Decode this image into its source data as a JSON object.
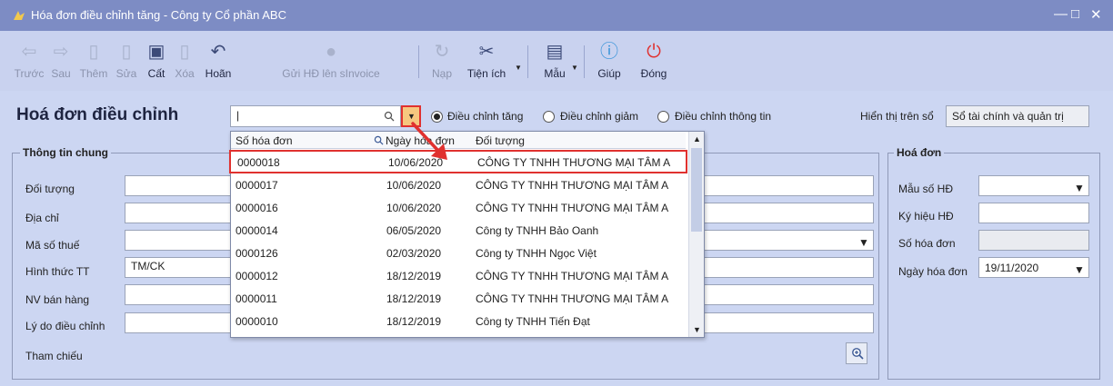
{
  "window": {
    "title": "Hóa đơn điều chỉnh tăng - Công ty Cổ phần ABC",
    "controls": [
      "—",
      "□",
      "✕"
    ]
  },
  "toolbar": {
    "buttons": [
      {
        "label": "Trước",
        "enabled": false
      },
      {
        "label": "Sau",
        "enabled": false
      },
      {
        "label": "Thêm",
        "enabled": false
      },
      {
        "label": "Sửa",
        "enabled": false
      },
      {
        "label": "Cất",
        "enabled": true
      },
      {
        "label": "Xóa",
        "enabled": false
      },
      {
        "label": "Hoãn",
        "enabled": true
      },
      {
        "label": "Gửi HĐ lên sInvoice",
        "enabled": false
      },
      {
        "label": "Nạp",
        "enabled": false
      },
      {
        "label": "Tiện ích",
        "enabled": true
      },
      {
        "label": "Mẫu",
        "enabled": true
      },
      {
        "label": "Giúp",
        "enabled": true
      },
      {
        "label": "Đóng",
        "enabled": true
      }
    ]
  },
  "form": {
    "heading": "Hoá đơn điều chỉnh",
    "search_value": "|",
    "radios": [
      {
        "label": "Điều chỉnh tăng",
        "checked": true
      },
      {
        "label": "Điều chỉnh giảm",
        "checked": false
      },
      {
        "label": "Điều chỉnh thông tin",
        "checked": false
      }
    ],
    "display_label": "Hiển thị trên sổ",
    "display_value": "Sổ tài chính và quản trị"
  },
  "general": {
    "title": "Thông tin chung",
    "fields": [
      {
        "label": "Đối tượng",
        "value": ""
      },
      {
        "label": "Địa chỉ",
        "value": ""
      },
      {
        "label": "Mã số thuế",
        "value": ""
      },
      {
        "label": "Hình thức TT",
        "value": "TM/CK"
      },
      {
        "label": "NV bán hàng",
        "value": ""
      },
      {
        "label": "Lý do điều chỉnh",
        "value": ""
      }
    ],
    "reference_label": "Tham chiếu"
  },
  "invoice": {
    "title": "Hoá đơn",
    "fields": [
      {
        "label": "Mẫu số HĐ",
        "value": ""
      },
      {
        "label": "Ký hiệu HĐ",
        "value": ""
      },
      {
        "label": "Số hóa đơn",
        "value": ""
      },
      {
        "label": "Ngày hóa đơn",
        "value": "19/11/2020"
      }
    ]
  },
  "dropdown": {
    "columns": [
      "Số hóa đơn",
      "Ngày hóa đơn",
      "Đối tượng"
    ],
    "rows": [
      {
        "number": "0000018",
        "date": "10/06/2020",
        "customer": "CÔNG TY TNHH THƯƠNG MẠI TÂM A"
      },
      {
        "number": "0000017",
        "date": "10/06/2020",
        "customer": "CÔNG TY TNHH THƯƠNG MẠI TÂM A"
      },
      {
        "number": "0000016",
        "date": "10/06/2020",
        "customer": "CÔNG TY TNHH THƯƠNG MẠI TÂM A"
      },
      {
        "number": "0000014",
        "date": "06/05/2020",
        "customer": "Công ty TNHH Bảo Oanh"
      },
      {
        "number": "0000126",
        "date": "02/03/2020",
        "customer": "Công ty TNHH Ngọc Việt"
      },
      {
        "number": "0000012",
        "date": "18/12/2019",
        "customer": "CÔNG TY TNHH THƯƠNG MẠI TÂM A"
      },
      {
        "number": "0000011",
        "date": "18/12/2019",
        "customer": "CÔNG TY TNHH THƯƠNG MẠI TÂM A"
      },
      {
        "number": "0000010",
        "date": "18/12/2019",
        "customer": "Công ty TNHH Tiến Đạt"
      }
    ],
    "highlighted_row": 0
  },
  "colors": {
    "titlebar": "#7d8cc4",
    "toolbar": "#c9d2ef",
    "content": "#ccd6f2",
    "highlight": "#e0312f"
  }
}
